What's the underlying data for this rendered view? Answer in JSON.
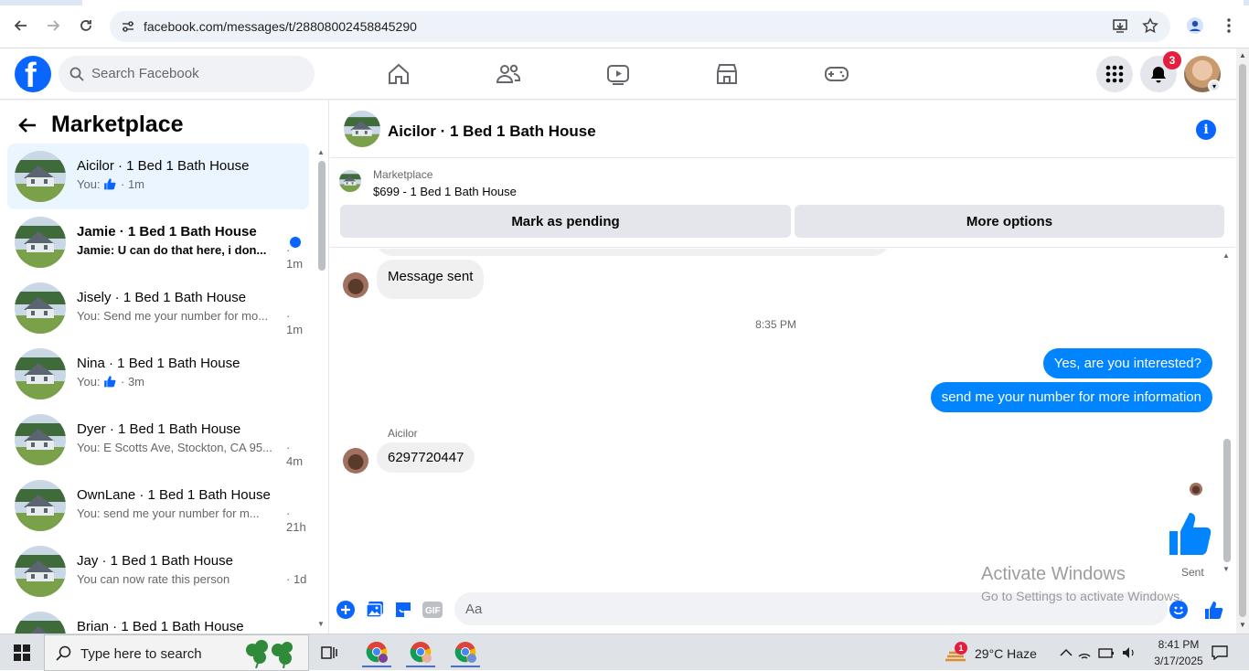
{
  "browser": {
    "url": "facebook.com/messages/t/28808002458845290"
  },
  "header": {
    "logo": "f",
    "search_placeholder": "Search Facebook",
    "notification_count": "3"
  },
  "sidebar": {
    "title": "Marketplace",
    "conversations": [
      {
        "name": "Aicilor · 1 Bed 1 Bath House",
        "prefix": "You:",
        "snippet": "",
        "has_like": true,
        "time": "· 1m",
        "active": true,
        "unread": false
      },
      {
        "name": "Jamie · 1 Bed 1 Bath House",
        "prefix": "",
        "snippet": "Jamie: U can do that here, i don...",
        "has_like": false,
        "time": "· 1m",
        "active": false,
        "unread": true
      },
      {
        "name": "Jisely · 1 Bed 1 Bath House",
        "prefix": "",
        "snippet": "You: Send me your number for mo...",
        "has_like": false,
        "time": "· 1m",
        "active": false,
        "unread": false
      },
      {
        "name": "Nina · 1 Bed 1 Bath House",
        "prefix": "You:",
        "snippet": "",
        "has_like": true,
        "time": "· 3m",
        "active": false,
        "unread": false
      },
      {
        "name": "Dyer · 1 Bed 1 Bath House",
        "prefix": "",
        "snippet": "You: E Scotts Ave, Stockton, CA 95...",
        "has_like": false,
        "time": "· 4m",
        "active": false,
        "unread": false
      },
      {
        "name": "OwnLane · 1 Bed 1 Bath House",
        "prefix": "",
        "snippet": "You: send me your number for m...",
        "has_like": false,
        "time": "· 21h",
        "active": false,
        "unread": false
      },
      {
        "name": "Jay · 1 Bed 1 Bath House",
        "prefix": "",
        "snippet": "You can now rate this person",
        "has_like": false,
        "time": "· 1d",
        "active": false,
        "unread": false
      },
      {
        "name": "Brian · 1 Bed 1 Bath House",
        "prefix": "",
        "snippet": "",
        "has_like": false,
        "time": "",
        "active": false,
        "unread": false
      }
    ]
  },
  "chat": {
    "title": "Aicilor · 1 Bed 1 Bath House",
    "listing_label": "Marketplace",
    "listing_title": "$699 - 1 Bed 1 Bath House",
    "mark_pending_label": "Mark as pending",
    "more_options_label": "More options",
    "messages": {
      "message_sent": "Message sent",
      "timestamp": "8:35 PM",
      "out1": "Yes, are you interested?",
      "out2": "send me your number for more information",
      "sender_name": "Aicilor",
      "in_phone": "6297720447",
      "sent_status": "Sent"
    },
    "composer_placeholder": "Aa"
  },
  "watermark": {
    "line1": "Activate Windows",
    "line2": "Go to Settings to activate Windows."
  },
  "taskbar": {
    "search_placeholder": "Type here to search",
    "weather_alert_count": "1",
    "weather": "29°C  Haze",
    "time": "8:41 PM",
    "date": "3/17/2025"
  },
  "colors": {
    "fb_blue": "#0866ff",
    "messenger_blue": "#0084ff",
    "active_row": "#ebf5ff"
  }
}
